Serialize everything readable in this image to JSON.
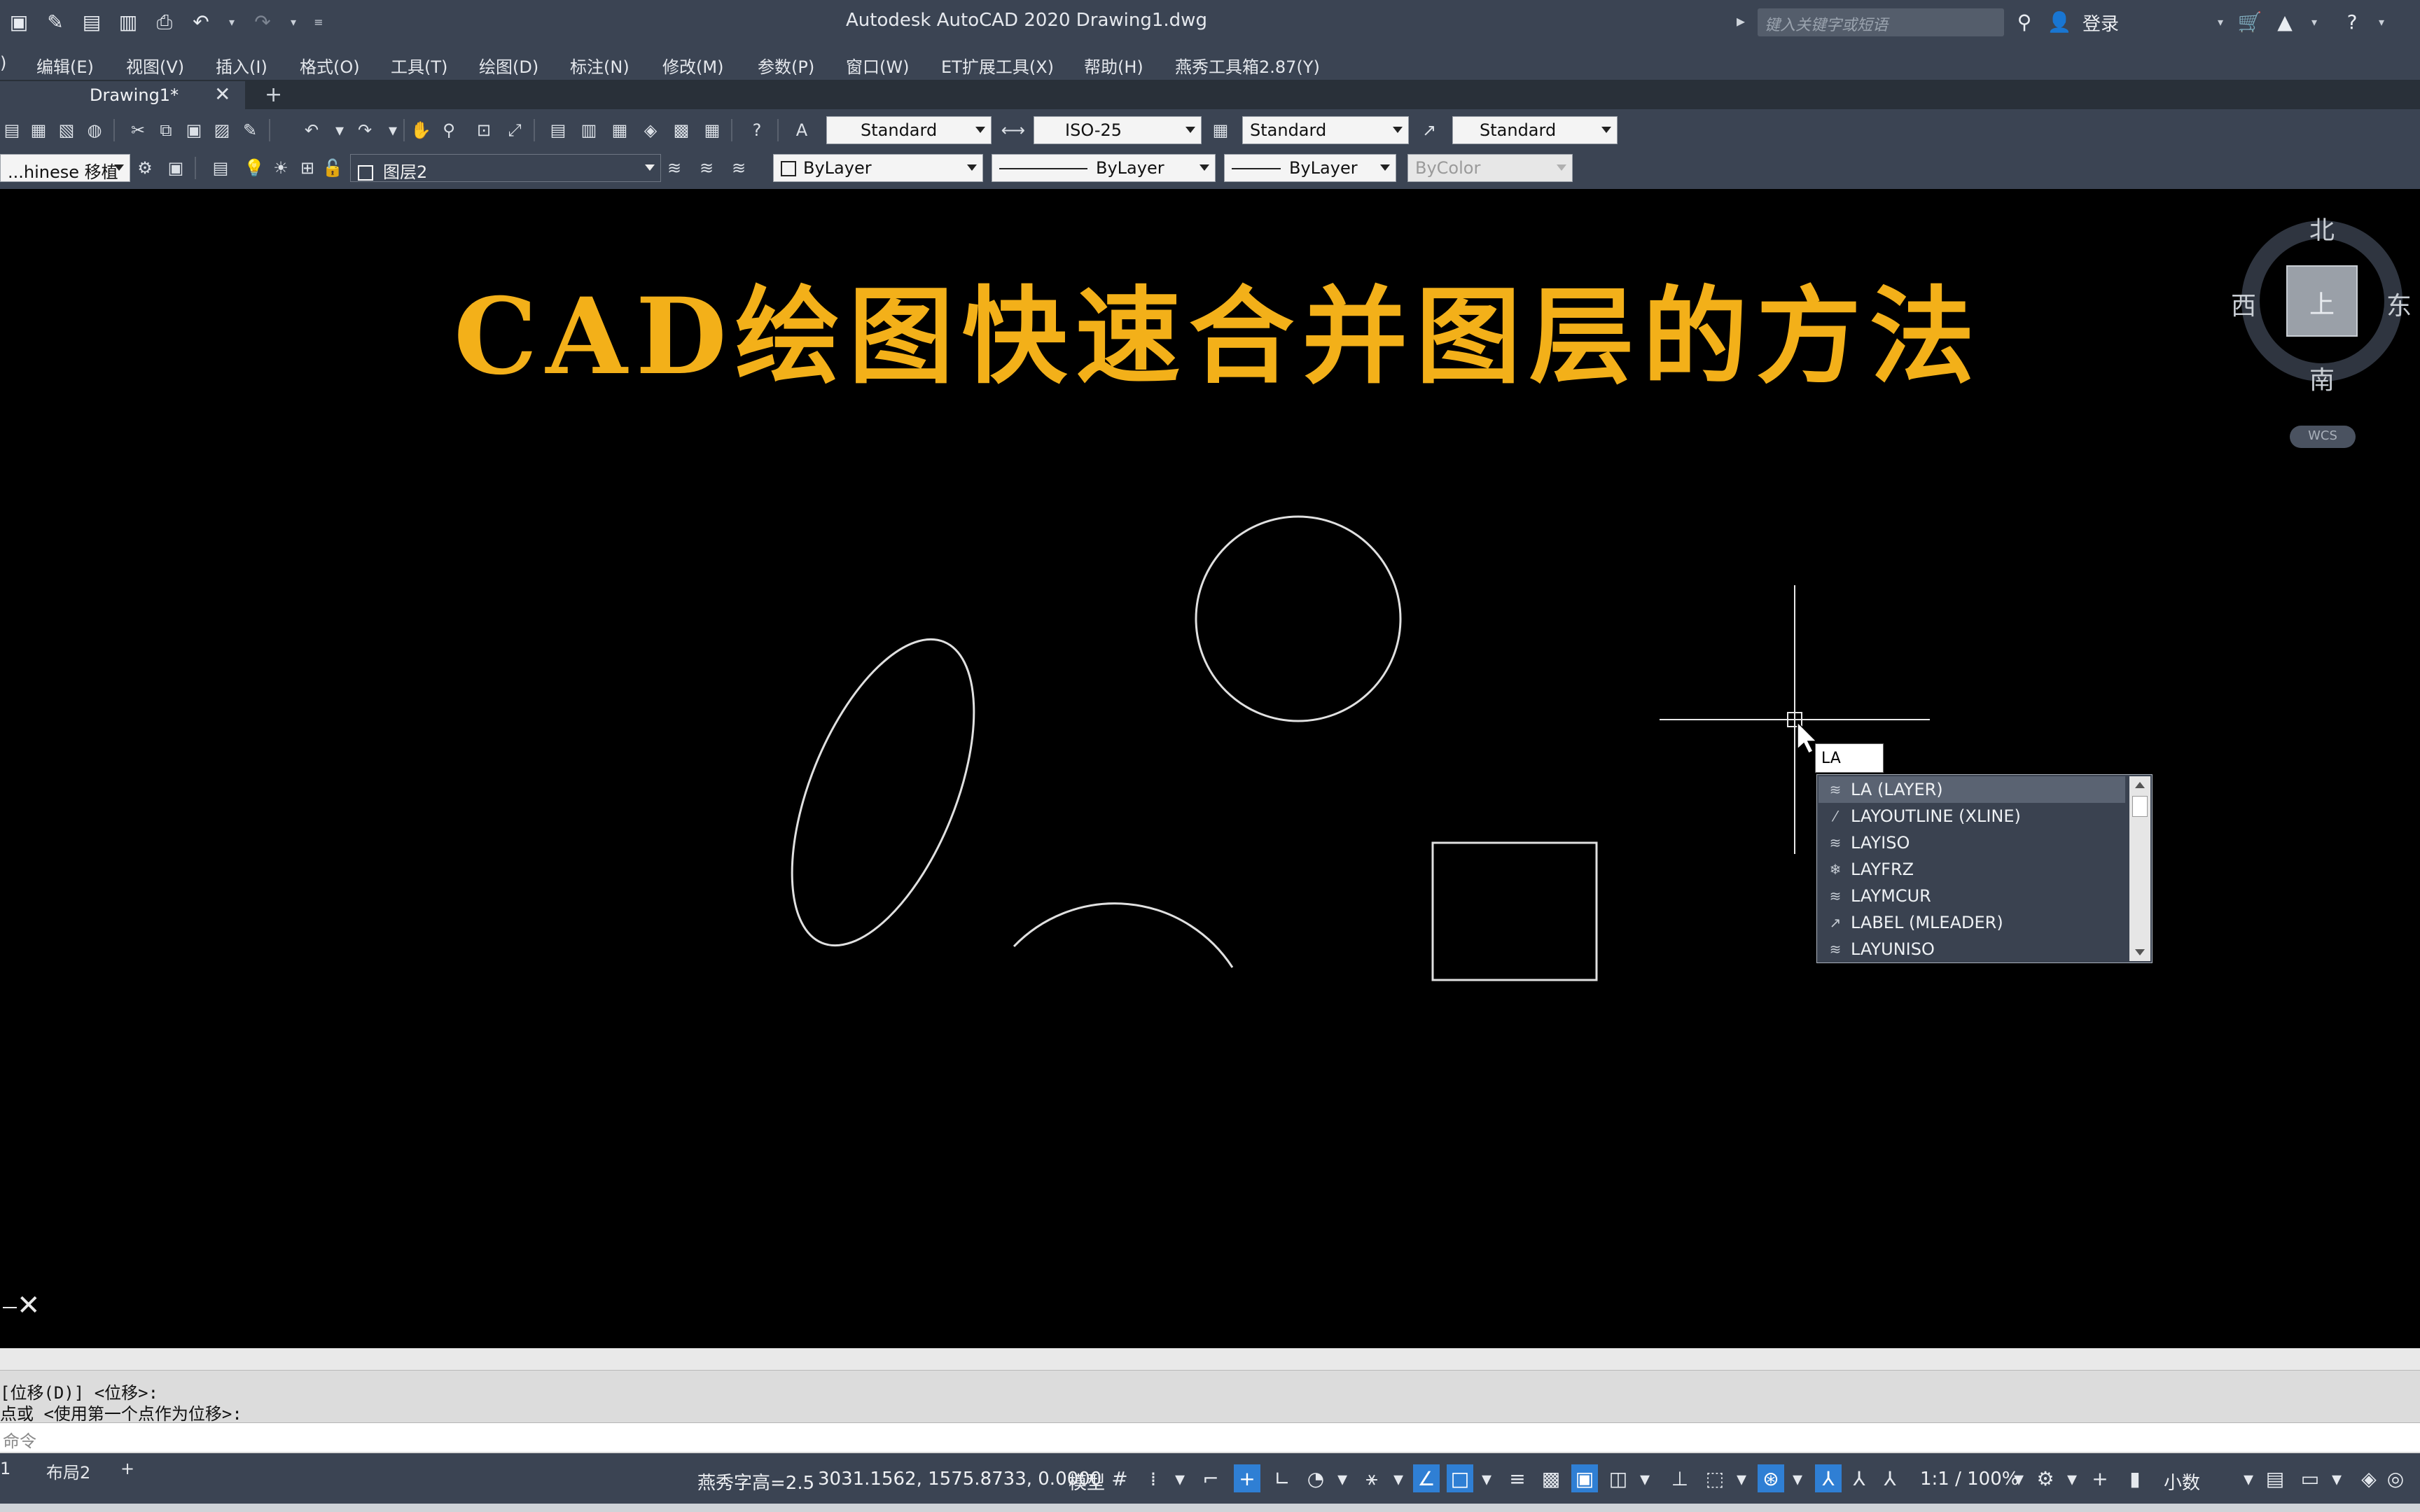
{
  "window": {
    "app_title": "Autodesk AutoCAD 2020    Drawing1.dwg",
    "search_placeholder": "键入关键字或短语",
    "login_label": "登录"
  },
  "menu": {
    "items": [
      "编辑(E)",
      "视图(V)",
      "插入(I)",
      "格式(O)",
      "工具(T)",
      "绘图(D)",
      "标注(N)",
      "修改(M)",
      "参数(P)",
      "窗口(W)",
      "ET扩展工具(X)",
      "帮助(H)",
      "燕秀工具箱2.87(Y)"
    ]
  },
  "tabs": {
    "doc_tab_label": "Drawing1*",
    "close_glyph": "✕",
    "new_tab_glyph": "+"
  },
  "toolbar": {
    "text_style": "Standard",
    "dim_style": "ISO-25",
    "table_style": "Standard",
    "mleader_style": "Standard",
    "workspace": "...hinese 移植",
    "layer_name": "图层2",
    "color": "ByLayer",
    "linetype": "ByLayer",
    "lineweight": "ByLayer",
    "plot_style": "ByColor"
  },
  "canvas": {
    "title": "CAD绘图快速合并图层的方法"
  },
  "viewcube": {
    "north": "北",
    "south": "南",
    "east": "东",
    "west": "西",
    "face": "上",
    "wcs": "WCS"
  },
  "command": {
    "typed": "LA",
    "suggestions": [
      {
        "label": "LA (LAYER)",
        "icon": "layer-icon"
      },
      {
        "label": "LAYOUTLINE (XLINE)",
        "icon": "xline-icon"
      },
      {
        "label": "LAYISO",
        "icon": "layiso-icon"
      },
      {
        "label": "LAYFRZ",
        "icon": "layfrz-icon"
      },
      {
        "label": "LAYMCUR",
        "icon": "laymcur-icon"
      },
      {
        "label": "LABEL (MLEADER)",
        "icon": "mleader-icon"
      },
      {
        "label": "LAYUNISO",
        "icon": "layuniso-icon"
      }
    ],
    "history_line1": "[位移(D)] <位移>:",
    "history_line2": "点或 <使用第一个点作为位移>:",
    "input_placeholder": "命令"
  },
  "status": {
    "layout_tabs": [
      "1",
      "布局2"
    ],
    "add_tab": "+",
    "text_height": "燕秀字高=2.5",
    "coordinates": "3031.1562, 1575.8733, 0.0000",
    "space": "模型",
    "scale": "1:1 / 100%",
    "units": "小数"
  }
}
